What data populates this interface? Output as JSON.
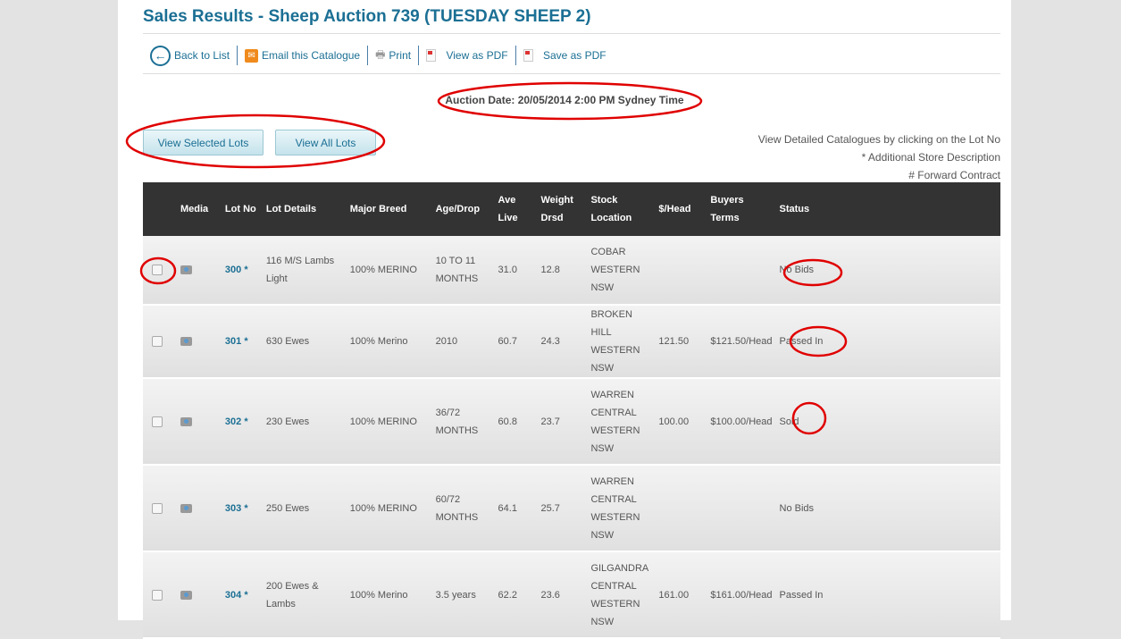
{
  "title": "Sales Results - Sheep Auction 739 (TUESDAY SHEEP 2)",
  "toolbar": {
    "back": "Back to List",
    "email": "Email this Catalogue",
    "print": "Print",
    "view_pdf": "View as PDF",
    "save_pdf": "Save as PDF"
  },
  "auction_date": "Auction Date: 20/05/2014 2:00 PM Sydney Time",
  "buttons": {
    "selected": "View Selected Lots",
    "all": "View All Lots"
  },
  "notes": [
    "View Detailed Catalogues by clicking on the Lot No",
    "* Additional Store Description",
    "# Forward Contract"
  ],
  "columns": [
    "",
    "Media",
    "Lot No",
    "Lot Details",
    "Major Breed",
    "Age/Drop",
    "Ave Live",
    "Weight Drsd",
    "Stock Location",
    "$/Head",
    "Buyers Terms",
    "Status"
  ],
  "rows": [
    {
      "lot": "300 *",
      "details": "116 M/S Lambs Light",
      "breed": "100% MERINO",
      "age": "10 TO 11 MONTHS",
      "live": "31.0",
      "drsd": "12.8",
      "location": "COBAR WESTERN NSW",
      "head": "",
      "terms": "",
      "status": "No Bids"
    },
    {
      "lot": "301 *",
      "details": "630 Ewes",
      "breed": "100% Merino",
      "age": "2010",
      "live": "60.7",
      "drsd": "24.3",
      "location": "BROKEN HILL WESTERN NSW",
      "head": "121.50",
      "terms": "$121.50/Head",
      "status": "Passed In"
    },
    {
      "lot": "302 *",
      "details": "230 Ewes",
      "breed": "100% MERINO",
      "age": "36/72 MONTHS",
      "live": "60.8",
      "drsd": "23.7",
      "location": "WARREN CENTRAL WESTERN NSW",
      "head": "100.00",
      "terms": "$100.00/Head",
      "status": "Sold"
    },
    {
      "lot": "303 *",
      "details": "250 Ewes",
      "breed": "100% MERINO",
      "age": "60/72 MONTHS",
      "live": "64.1",
      "drsd": "25.7",
      "location": "WARREN CENTRAL WESTERN NSW",
      "head": "",
      "terms": "",
      "status": "No Bids"
    },
    {
      "lot": "304 *",
      "details": "200 Ewes & Lambs",
      "breed": "100% Merino",
      "age": "3.5 years",
      "live": "62.2",
      "drsd": "23.6",
      "location": "GILGANDRA CENTRAL WESTERN NSW",
      "head": "161.00",
      "terms": "$161.00/Head",
      "status": "Passed In"
    }
  ],
  "annotation_color": "#e00000"
}
